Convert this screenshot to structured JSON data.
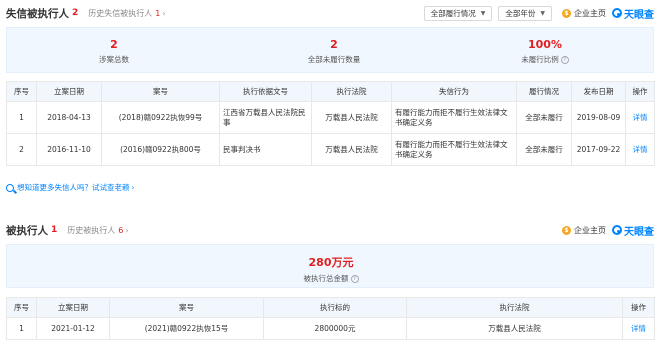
{
  "section1": {
    "title": "失信被执行人",
    "count": "2",
    "history_label": "历史失信被执行人",
    "history_count": "1",
    "filter_status": "全部履行情况",
    "filter_year": "全部年份",
    "enterprise_label": "企业主页",
    "logo": "天眼查",
    "stats": [
      {
        "value": "2",
        "label": "涉案总数"
      },
      {
        "value": "2",
        "label": "全部未履行数量"
      },
      {
        "value": "100%",
        "label": "未履行比例"
      }
    ],
    "columns": [
      "序号",
      "立案日期",
      "案号",
      "执行依据文号",
      "执行法院",
      "失信行为",
      "履行情况",
      "发布日期",
      "操作"
    ],
    "rows": [
      {
        "no": "1",
        "date": "2018-04-13",
        "case": "(2018)赣0922执恢99号",
        "basis": "江西省万载县人民法院民事",
        "court": "万载县人民法院",
        "behavior": "有履行能力而拒不履行生效法律文书确定义务",
        "status": "全部未履行",
        "publish": "2019-08-09",
        "action": "详情"
      },
      {
        "no": "2",
        "date": "2016-11-10",
        "case": "(2016)赣0922执800号",
        "basis": "民事判决书",
        "court": "万载县人民法院",
        "behavior": "有履行能力而拒不履行生效法律文书确定义务",
        "status": "全部未履行",
        "publish": "2017-09-22",
        "action": "详情"
      }
    ],
    "more_link": "想知道更多失信人吗？试试查老赖"
  },
  "section2": {
    "title": "被执行人",
    "count": "1",
    "history_label": "历史被执行人",
    "history_count": "6",
    "enterprise_label": "企业主页",
    "logo": "天眼查",
    "stat": {
      "value": "280万元",
      "label": "被执行总金额"
    },
    "columns": [
      "序号",
      "立案日期",
      "案号",
      "执行标的",
      "执行法院",
      "操作"
    ],
    "rows": [
      {
        "no": "1",
        "date": "2021-01-12",
        "case": "(2021)赣0922执恢15号",
        "amount": "2800000元",
        "court": "万载县人民法院",
        "action": "详情"
      }
    ]
  }
}
